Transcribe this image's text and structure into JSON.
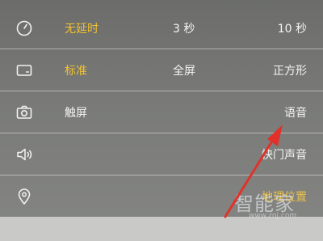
{
  "rows": [
    {
      "icon": "timer-icon",
      "col1": "无延时",
      "col2": "3 秒",
      "col3": "10 秒"
    },
    {
      "icon": "aspect-ratio-icon",
      "col1": "标准",
      "col2": "全屏",
      "col3": "正方形"
    },
    {
      "icon": "camera-icon",
      "col1": "触屏",
      "col3": "语音"
    },
    {
      "icon": "speaker-icon",
      "col3": "快门声音"
    },
    {
      "icon": "location-pin-icon",
      "col3": "地理位置"
    }
  ],
  "watermark": {
    "text": "智能家",
    "sub": "www.znj.com"
  },
  "colors": {
    "active": "#f1c232",
    "text": "#f4f4f2",
    "arrow": "#e0322a"
  }
}
